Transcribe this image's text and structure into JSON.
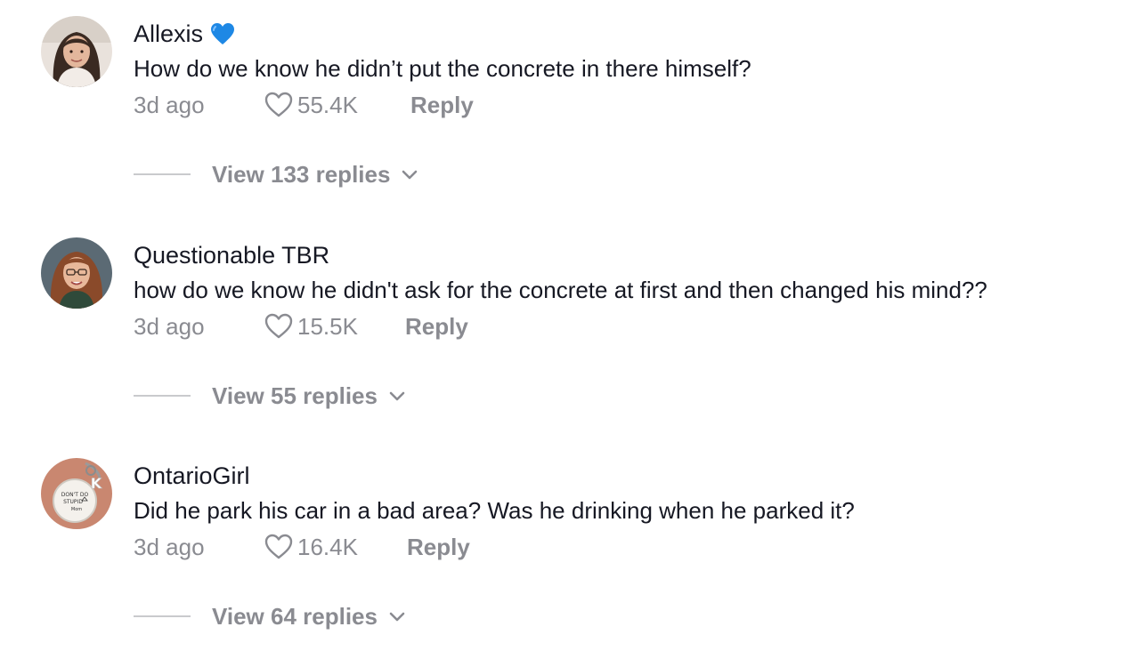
{
  "comments": [
    {
      "username": "Allexis",
      "badge_icon": "blue-heart-icon",
      "text": "How do we know he didn’t put the concrete in there himself?",
      "age": "3d ago",
      "likes": "55.4K",
      "reply_label": "Reply",
      "view_replies_label": "View 133 replies"
    },
    {
      "username": "Questionable TBR",
      "text": "how do we know he didn't ask for the concrete at first and then changed his mind??",
      "age": "3d ago",
      "likes": "15.5K",
      "reply_label": "Reply",
      "view_replies_label": "View 55 replies"
    },
    {
      "username": "OntarioGirl",
      "text": "Did he park his car in a bad area? Was he drinking when he parked it?",
      "age": "3d ago",
      "likes": "16.4K",
      "reply_label": "Reply",
      "view_replies_label": "View 64 replies"
    }
  ],
  "avatar_keychain_text": [
    "DON'T DO",
    "STUPID",
    "Mom"
  ],
  "avatar_keychain_letter": "K",
  "colors": {
    "text_primary": "#161823",
    "text_secondary": "#8a8b91",
    "badge_blue": "#1e88e5",
    "divider": "#c9cacd"
  },
  "icons": {
    "like": "heart-outline-icon",
    "expand": "chevron-down-icon"
  }
}
